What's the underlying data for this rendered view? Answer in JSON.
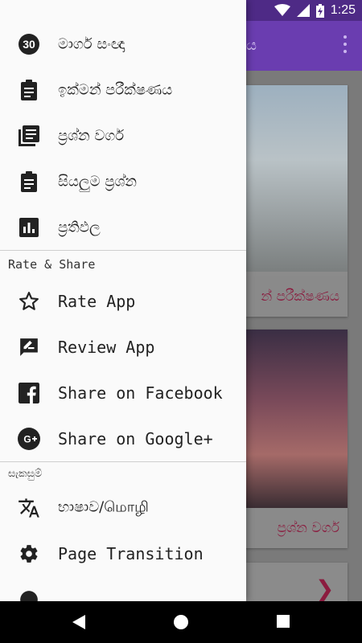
{
  "status": {
    "time": "1:25"
  },
  "app": {
    "title_partial": "ය",
    "cards": [
      {
        "caption": "න් පරීක්ෂණය"
      },
      {
        "caption": "ප්‍රශ්න වර්ග"
      }
    ]
  },
  "drawer": {
    "main_items": [
      {
        "label": "මාර්ග සංඥා",
        "icon": "thirty-badge-icon"
      },
      {
        "label": "ඉක්මන් පරීක්ෂණය",
        "icon": "clipboard-icon"
      },
      {
        "label": "ප්‍රශ්න වර්ග",
        "icon": "library-books-icon"
      },
      {
        "label": "සියලුම ප්‍රශ්න",
        "icon": "clipboard-icon"
      },
      {
        "label": "ප්‍රතිඵල",
        "icon": "bar-chart-icon"
      }
    ],
    "rate_share_header": "Rate & Share",
    "rate_share_items": [
      {
        "label": "Rate App",
        "icon": "star-outline-icon"
      },
      {
        "label": "Review App",
        "icon": "rate-review-icon"
      },
      {
        "label": "Share on Facebook",
        "icon": "facebook-icon"
      },
      {
        "label": "Share on Google+",
        "icon": "google-plus-icon"
      }
    ],
    "settings_header": "සැකසුම්",
    "settings_items": [
      {
        "label": "භාෂාව/மொழி",
        "icon": "translate-icon"
      },
      {
        "label": "Page Transition",
        "icon": "gear-icon"
      }
    ]
  }
}
